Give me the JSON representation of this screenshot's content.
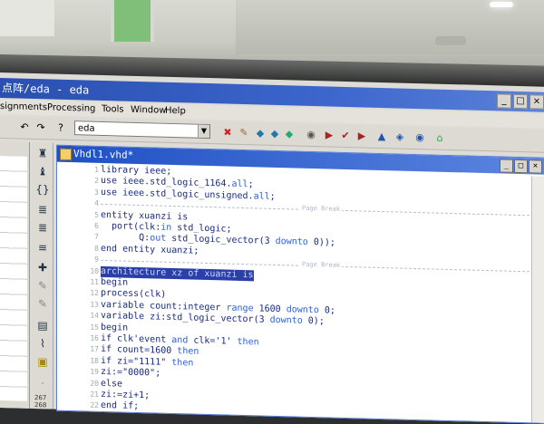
{
  "window": {
    "title": "点阵/eda - eda",
    "min": "_",
    "max": "□",
    "close": "×"
  },
  "menu": [
    "signments",
    "Processing",
    "Tools",
    "Window",
    "Help"
  ],
  "toolbar": {
    "project_combo": "eda",
    "combo_arrow": "▼"
  },
  "editor": {
    "tab_title": "Vhdl1.vhd*",
    "page_break_label": "Page Break",
    "lines": [
      {
        "n": "1",
        "segments": [
          {
            "t": "library ieee;",
            "k": false
          }
        ]
      },
      {
        "n": "2",
        "segments": [
          {
            "t": "use ieee.std_logic_1164.",
            "k": false
          },
          {
            "t": "all",
            "k": true
          },
          {
            "t": ";",
            "k": false
          }
        ]
      },
      {
        "n": "3",
        "segments": [
          {
            "t": "use ieee.std_logic_unsigned.",
            "k": false
          },
          {
            "t": "all",
            "k": true
          },
          {
            "t": ";",
            "k": false
          }
        ]
      },
      {
        "n": "4",
        "segments": [
          {
            "t": "",
            "k": false
          }
        ]
      },
      {
        "n": "5",
        "segments": [
          {
            "t": "entity xuanzi is",
            "k": false
          }
        ]
      },
      {
        "n": "6",
        "segments": [
          {
            "t": "  port(clk:",
            "k": false
          },
          {
            "t": "in",
            "k": true
          },
          {
            "t": " std_logic;",
            "k": false
          }
        ]
      },
      {
        "n": "7",
        "segments": [
          {
            "t": "       Q:",
            "k": false
          },
          {
            "t": "out",
            "k": true
          },
          {
            "t": " std_logic_vector(3 ",
            "k": false
          },
          {
            "t": "downto",
            "k": true
          },
          {
            "t": " 0));",
            "k": false
          }
        ]
      },
      {
        "n": "8",
        "segments": [
          {
            "t": "end entity xuanzi;",
            "k": false
          }
        ]
      },
      {
        "n": "9",
        "segments": [
          {
            "t": "",
            "k": false
          }
        ]
      },
      {
        "n": "10",
        "segments": [
          {
            "t": "architecture xz of xuanzi is",
            "k": false
          }
        ],
        "highlight": true
      },
      {
        "n": "11",
        "segments": [
          {
            "t": "begin",
            "k": false
          }
        ]
      },
      {
        "n": "12",
        "segments": [
          {
            "t": "process(clk)",
            "k": false
          }
        ]
      },
      {
        "n": "13",
        "segments": [
          {
            "t": "variable count:integer ",
            "k": false
          },
          {
            "t": "range",
            "k": true
          },
          {
            "t": " 1600 ",
            "k": false
          },
          {
            "t": "downto",
            "k": true
          },
          {
            "t": " 0;",
            "k": false
          }
        ]
      },
      {
        "n": "14",
        "segments": [
          {
            "t": "variable zi:std_logic_vector(3 ",
            "k": false
          },
          {
            "t": "downto",
            "k": true
          },
          {
            "t": " 0);",
            "k": false
          }
        ]
      },
      {
        "n": "15",
        "segments": [
          {
            "t": "begin",
            "k": false
          }
        ]
      },
      {
        "n": "16",
        "segments": [
          {
            "t": "if clk'event ",
            "k": false
          },
          {
            "t": "and",
            "k": true
          },
          {
            "t": " clk='1' ",
            "k": false
          },
          {
            "t": "then",
            "k": true
          }
        ]
      },
      {
        "n": "17",
        "segments": [
          {
            "t": "if count=1600 ",
            "k": false
          },
          {
            "t": "then",
            "k": true
          }
        ]
      },
      {
        "n": "18",
        "segments": [
          {
            "t": "if zi=\"1111\" ",
            "k": false
          },
          {
            "t": "then",
            "k": true
          }
        ]
      },
      {
        "n": "19",
        "segments": [
          {
            "t": "zi:=\"0000\";",
            "k": false
          }
        ]
      },
      {
        "n": "20",
        "segments": [
          {
            "t": "else",
            "k": false
          }
        ]
      },
      {
        "n": "21",
        "segments": [
          {
            "t": "zi:=zi+1;",
            "k": false
          }
        ]
      },
      {
        "n": "22",
        "segments": [
          {
            "t": "end if;",
            "k": false
          }
        ]
      }
    ]
  },
  "sidebar": {
    "num_top": "267",
    "num_bottom": "268",
    "ab_label": "ab"
  }
}
